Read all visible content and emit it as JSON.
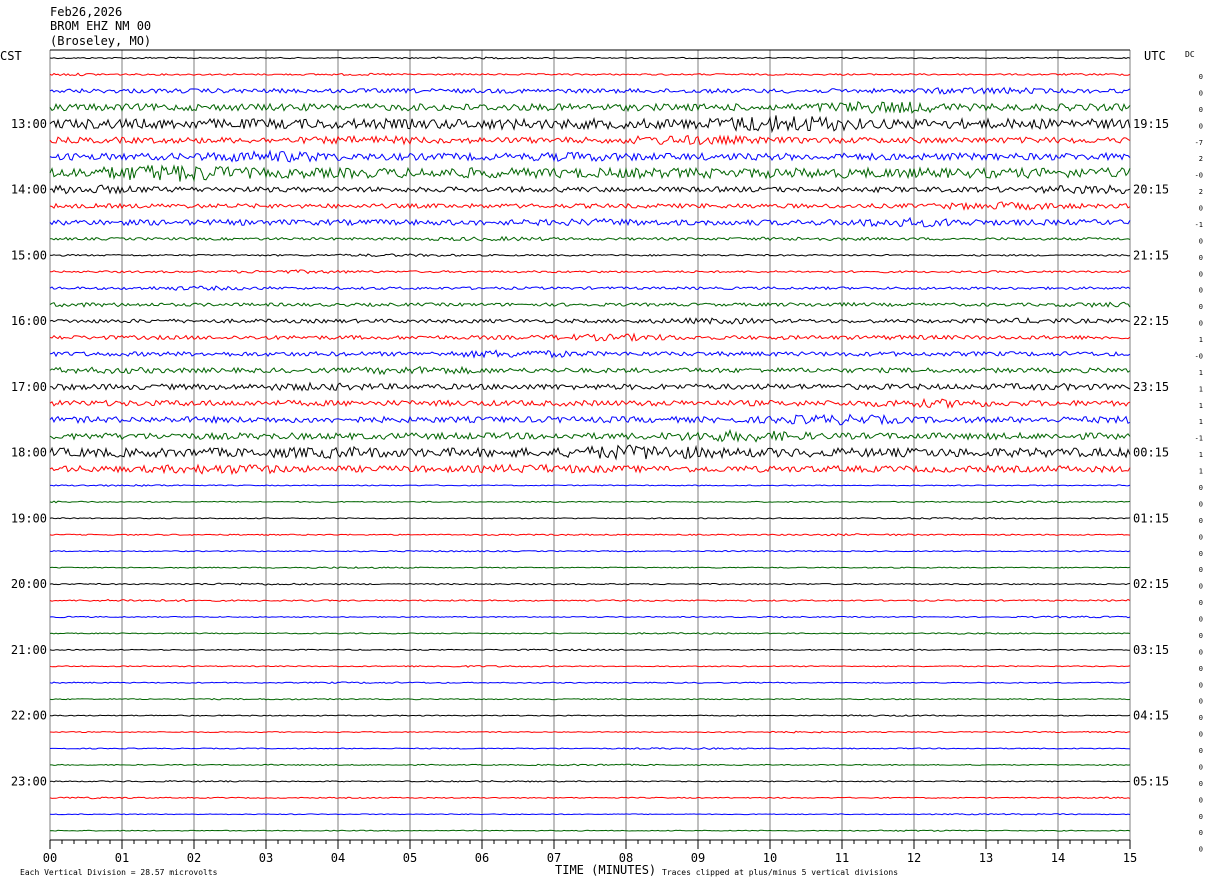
{
  "header": {
    "date": "Feb26,2026",
    "station": "BROM EHZ NM 00",
    "location": "(Broseley, MO)"
  },
  "axes": {
    "left_zone": "CST",
    "right_zone": "UTC",
    "dc_label": "DC",
    "x_title": "TIME (MINUTES)",
    "scale_note": "Each Vertical Division =   28.57 microvolts",
    "clip_note": "Traces clipped at plus/minus 5 vertical divisions"
  },
  "chart_data": {
    "type": "line",
    "title": "",
    "xlabel": "TIME (MINUTES)",
    "ylabel": "",
    "x_ticks": [
      "00",
      "01",
      "02",
      "03",
      "04",
      "05",
      "06",
      "07",
      "08",
      "09",
      "10",
      "11",
      "12",
      "13",
      "14",
      "15"
    ],
    "xlim": [
      0,
      15
    ],
    "grid": true,
    "num_traces": 48,
    "minutes_per_trace": 15,
    "trace_colors": [
      "#000000",
      "#ff0000",
      "#0000ff",
      "#006400"
    ],
    "left_time_labels": [
      "13:00",
      "14:00",
      "15:00",
      "16:00",
      "17:00",
      "18:00",
      "19:00",
      "20:00",
      "21:00",
      "22:00",
      "23:00"
    ],
    "left_label_trace_indices": [
      4,
      8,
      12,
      16,
      20,
      24,
      28,
      32,
      36,
      40,
      44
    ],
    "right_time_labels": [
      "19:15",
      "20:15",
      "21:15",
      "22:15",
      "23:15",
      "00:15",
      "01:15",
      "02:15",
      "03:15",
      "04:15",
      "05:15"
    ],
    "right_label_trace_indices": [
      4,
      8,
      12,
      16,
      20,
      24,
      28,
      32,
      36,
      40,
      44
    ],
    "dc_offsets": [
      "0",
      "0",
      "0",
      "0",
      "-7",
      "2",
      "-0",
      "2",
      "0",
      "-1",
      "0",
      "0",
      "0",
      "0",
      "0",
      "0",
      "1",
      "-0",
      "1",
      "1",
      "1",
      "1",
      "-1",
      "1",
      "1",
      "0",
      "0",
      "0",
      "0",
      "0",
      "0",
      "0",
      "0",
      "0",
      "0",
      "0",
      "0",
      "0",
      "0",
      "0",
      "0",
      "0",
      "0",
      "0",
      "0",
      "0",
      "0",
      "0"
    ],
    "activity_level": [
      0.6,
      0.8,
      2.2,
      3.5,
      5,
      3,
      3.5,
      5,
      2.6,
      2.2,
      2.8,
      1.3,
      0.8,
      1,
      1.3,
      1.6,
      1.9,
      2,
      2.2,
      2.4,
      2.8,
      2.8,
      3,
      3.2,
      4.5,
      3.2,
      0.5,
      0.5,
      0.5,
      0.6,
      0.5,
      0.5,
      0.6,
      0.7,
      0.5,
      0.5,
      0.5,
      0.5,
      0.5,
      0.5,
      0.5,
      0.5,
      0.5,
      0.5,
      0.5,
      0.5,
      0.4,
      0.4
    ]
  }
}
